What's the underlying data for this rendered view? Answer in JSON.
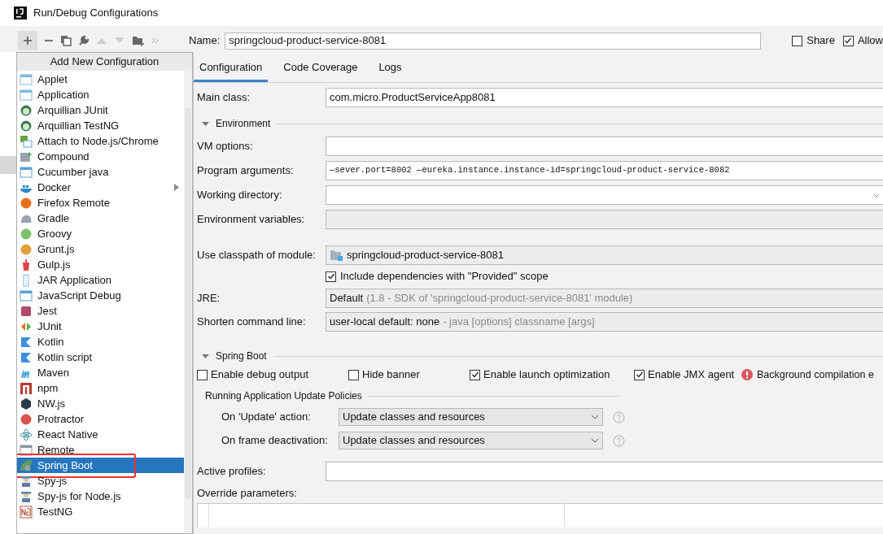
{
  "window": {
    "title": "Run/Debug Configurations"
  },
  "name_field": {
    "label": "Name:",
    "value": "springcloud-product-service-8081"
  },
  "options": [
    {
      "label": "Share",
      "checked": false
    },
    {
      "label": "Allow",
      "checked": true
    }
  ],
  "add_menu": {
    "title": "Add New Configuration",
    "items": [
      {
        "label": "Applet",
        "selected": false,
        "has_submenu": false,
        "highlighted": false
      },
      {
        "label": "Application",
        "selected": false,
        "has_submenu": false,
        "highlighted": false
      },
      {
        "label": "Arquillian JUnit",
        "selected": false,
        "has_submenu": false,
        "highlighted": false
      },
      {
        "label": "Arquillian TestNG",
        "selected": false,
        "has_submenu": false,
        "highlighted": false
      },
      {
        "label": "Attach to Node.js/Chrome",
        "selected": false,
        "has_submenu": false,
        "highlighted": false
      },
      {
        "label": "Compound",
        "selected": false,
        "has_submenu": false,
        "highlighted": false
      },
      {
        "label": "Cucumber java",
        "selected": false,
        "has_submenu": false,
        "highlighted": false
      },
      {
        "label": "Docker",
        "selected": false,
        "has_submenu": true,
        "highlighted": false
      },
      {
        "label": "Firefox Remote",
        "selected": false,
        "has_submenu": false,
        "highlighted": false
      },
      {
        "label": "Gradle",
        "selected": false,
        "has_submenu": false,
        "highlighted": false
      },
      {
        "label": "Groovy",
        "selected": false,
        "has_submenu": false,
        "highlighted": false
      },
      {
        "label": "Grunt.js",
        "selected": false,
        "has_submenu": false,
        "highlighted": false
      },
      {
        "label": "Gulp.js",
        "selected": false,
        "has_submenu": false,
        "highlighted": false
      },
      {
        "label": "JAR Application",
        "selected": false,
        "has_submenu": false,
        "highlighted": false
      },
      {
        "label": "JavaScript Debug",
        "selected": false,
        "has_submenu": false,
        "highlighted": false
      },
      {
        "label": "Jest",
        "selected": false,
        "has_submenu": false,
        "highlighted": false
      },
      {
        "label": "JUnit",
        "selected": false,
        "has_submenu": false,
        "highlighted": false
      },
      {
        "label": "Kotlin",
        "selected": false,
        "has_submenu": false,
        "highlighted": false
      },
      {
        "label": "Kotlin script",
        "selected": false,
        "has_submenu": false,
        "highlighted": false
      },
      {
        "label": "Maven",
        "selected": false,
        "has_submenu": false,
        "highlighted": false
      },
      {
        "label": "npm",
        "selected": false,
        "has_submenu": false,
        "highlighted": false
      },
      {
        "label": "NW.js",
        "selected": false,
        "has_submenu": false,
        "highlighted": false
      },
      {
        "label": "Protractor",
        "selected": false,
        "has_submenu": false,
        "highlighted": false
      },
      {
        "label": "React Native",
        "selected": false,
        "has_submenu": false,
        "highlighted": false
      },
      {
        "label": "Remote",
        "selected": false,
        "has_submenu": false,
        "highlighted": false
      },
      {
        "label": "Spring Boot",
        "selected": true,
        "has_submenu": false,
        "highlighted": true
      },
      {
        "label": "Spy-js",
        "selected": false,
        "has_submenu": false,
        "highlighted": false
      },
      {
        "label": "Spy-js for Node.js",
        "selected": false,
        "has_submenu": false,
        "highlighted": false
      },
      {
        "label": "TestNG",
        "selected": false,
        "has_submenu": false,
        "highlighted": false
      }
    ]
  },
  "tabs": [
    {
      "label": "Configuration",
      "selected": true
    },
    {
      "label": "Code Coverage",
      "selected": false
    },
    {
      "label": "Logs",
      "selected": false
    }
  ],
  "main_class": {
    "label": "Main class:",
    "value": "com.micro.ProductServiceApp8081"
  },
  "environment": {
    "title": "Environment",
    "expanded": true,
    "fields": [
      {
        "kind": "text",
        "label": "VM options:"
      },
      {
        "kind": "args",
        "label": "Program arguments:",
        "value": "—sever.port=8002 —eureka.instance.instance-id=springcloud-product-service-8082"
      },
      {
        "kind": "path",
        "label": "Working directory:"
      },
      {
        "kind": "disabled",
        "label": "Environment variables:"
      }
    ]
  },
  "module": {
    "label": "Use classpath of module:",
    "value": "springcloud-product-service-8081"
  },
  "include_deps": {
    "label": "Include dependencies with \"Provided\" scope",
    "checked": true
  },
  "jre": {
    "label": "JRE:",
    "value": "Default",
    "hint": "(1.8 - SDK of 'springcloud-product-service-8081' module)"
  },
  "shorten": {
    "label": "Shorten command line:",
    "value": "user-local default: none",
    "hint": "- java [options] classname [args]"
  },
  "spring_boot": {
    "title": "Spring Boot",
    "expanded": true,
    "options": [
      {
        "label": "Enable debug output",
        "checked": false
      },
      {
        "label": "Hide banner",
        "checked": false
      },
      {
        "label": "Enable launch optimization",
        "checked": true
      },
      {
        "label": "Enable JMX agent",
        "checked": true
      }
    ],
    "warning": "Background compilation e",
    "policies": {
      "title": "Running Application Update Policies",
      "rows": [
        {
          "label": "On 'Update' action:",
          "value": "Update classes and resources"
        },
        {
          "label": "On frame deactivation:",
          "value": "Update classes and resources"
        }
      ]
    }
  },
  "active_profiles": {
    "label": "Active profiles:"
  },
  "override": {
    "label": "Override parameters:"
  }
}
